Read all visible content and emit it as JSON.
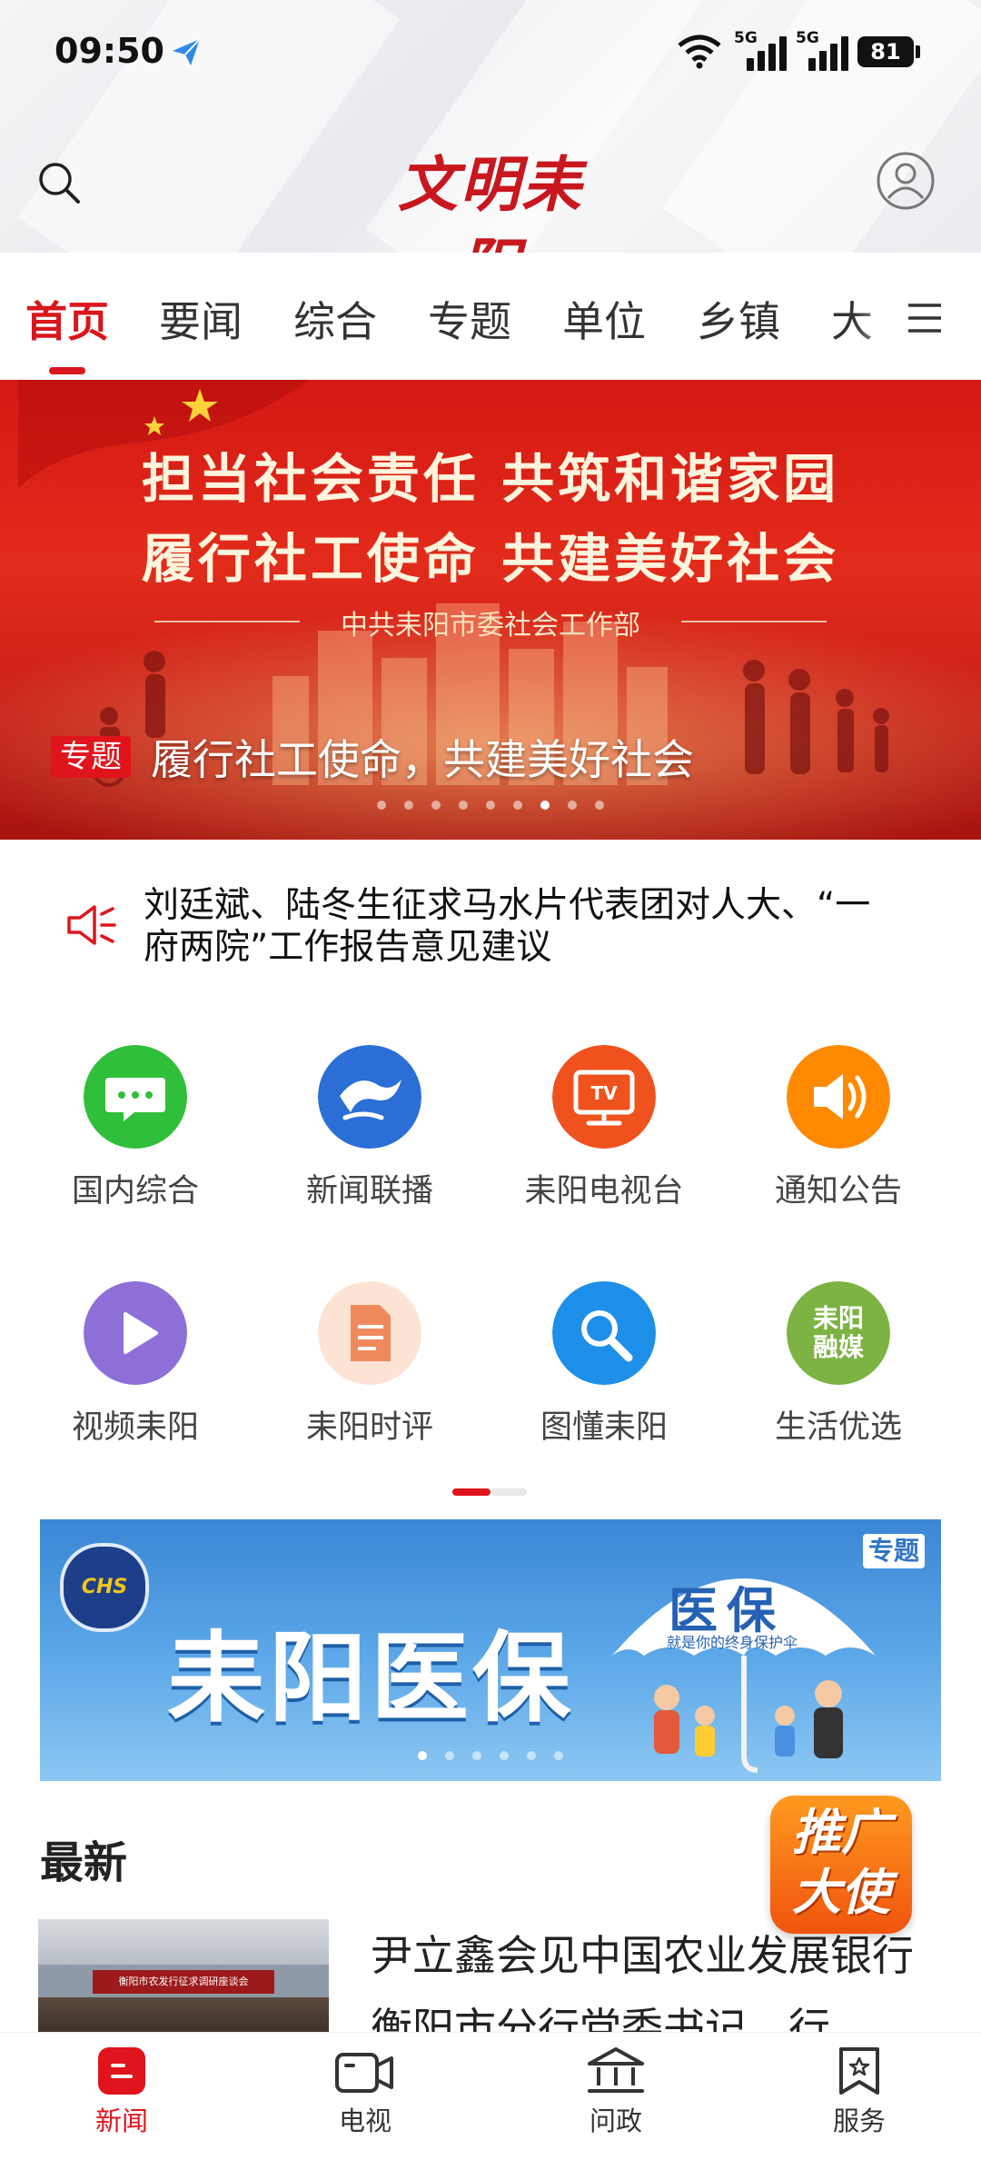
{
  "status_bar": {
    "time": "09:50",
    "signal1": "5G",
    "signal2": "5G",
    "battery": "81"
  },
  "header": {
    "logo_text": "文明耒阳",
    "search_icon": "search-icon",
    "user_icon": "user-icon"
  },
  "tabs": [
    {
      "label": "首页",
      "active": true
    },
    {
      "label": "要闻"
    },
    {
      "label": "综合"
    },
    {
      "label": "专题"
    },
    {
      "label": "单位"
    },
    {
      "label": "乡镇"
    },
    {
      "label": "大"
    }
  ],
  "banner": {
    "line1": "担当社会责任 共筑和谐家园",
    "line2": "履行社工使命 共建美好社会",
    "org": "中共耒阳市委社会工作部",
    "tag": "专题",
    "title": "履行社工使命，共建美好社会",
    "slide_count": 9,
    "active_slide": 7
  },
  "notice": {
    "text": "刘廷斌、陆冬生征求马水片代表团对人大、“一府两院”工作报告意见建议"
  },
  "shortcuts": [
    {
      "label": "国内综合",
      "icon": "chat-bubble-icon",
      "color": "#2fbf3a"
    },
    {
      "label": "新闻联播",
      "icon": "wave-icon",
      "color": "#2b6fd6"
    },
    {
      "label": "耒阳电视台",
      "icon": "tv-icon",
      "color": "#f0521e"
    },
    {
      "label": "通知公告",
      "icon": "megaphone-icon",
      "color": "#ff8a00"
    },
    {
      "label": "视频耒阳",
      "icon": "play-icon",
      "color": "#8e6fd8"
    },
    {
      "label": "耒阳时评",
      "icon": "document-icon",
      "color": "#f08a5d"
    },
    {
      "label": "图懂耒阳",
      "icon": "magnifier-icon",
      "color": "#1d8fe8"
    },
    {
      "label": "生活优选",
      "icon": "laiyang-media-icon",
      "color": "#7cb342",
      "icon_text": "耒阳融媒"
    }
  ],
  "ad_banner": {
    "logo": "CHS",
    "headline": "耒阳医保",
    "tag": "专题",
    "umbrella_text": "医保",
    "umbrella_sub": "就是你的终身保护伞",
    "slide_count": 6,
    "active_slide": 1
  },
  "latest": {
    "section_title": "最新",
    "promo_line1": "推广",
    "promo_line2": "大使",
    "item": {
      "thumb_text": "衡阳市农发行征求调研座谈会",
      "title": "尹立鑫会见中国农业发展银行衡阳市分行党委书记、行"
    }
  },
  "bottom_nav": [
    {
      "label": "新闻",
      "icon": "news-icon",
      "active": true
    },
    {
      "label": "电视",
      "icon": "tv-camera-icon"
    },
    {
      "label": "问政",
      "icon": "government-icon"
    },
    {
      "label": "服务",
      "icon": "service-bookmark-icon"
    }
  ],
  "colors": {
    "accent": "#e0141c",
    "banner_red": "#d41814",
    "ad_blue": "#3b86d4"
  }
}
